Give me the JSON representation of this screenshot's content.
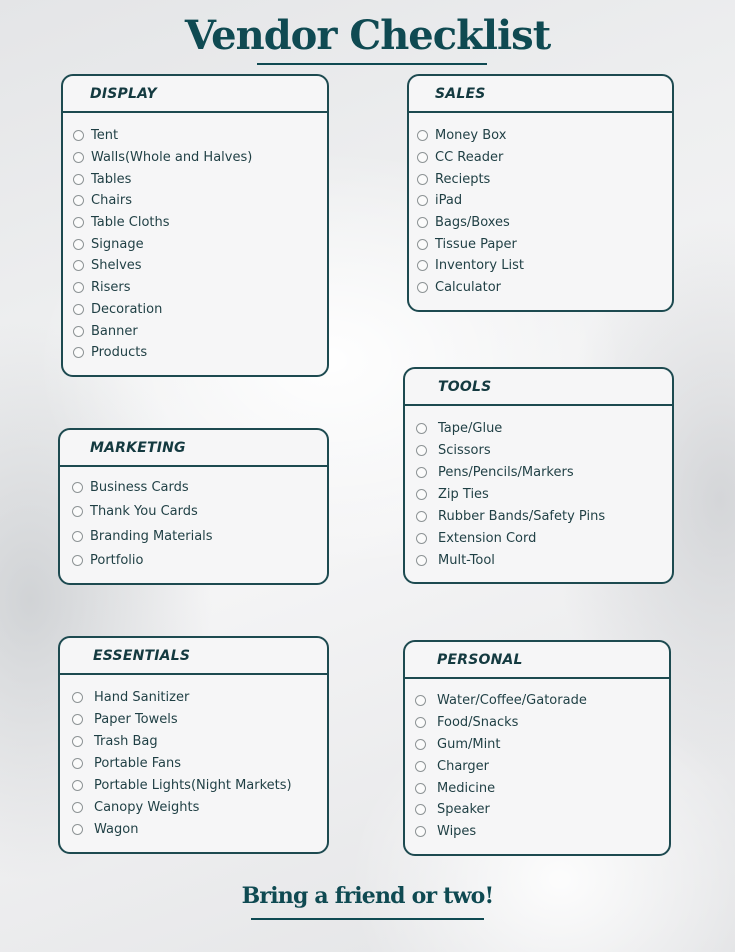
{
  "title": "Vendor Checklist",
  "footer": "Bring a friend or two!",
  "colors": {
    "accent": "#0f4a52",
    "border": "#1d4a50",
    "text": "#1f3f44",
    "card_bg": "#f6f6f7"
  },
  "sections": {
    "display": {
      "title": "DISPLAY",
      "items": [
        "Tent",
        "Walls(Whole and Halves)",
        "Tables",
        "Chairs",
        "Table Cloths",
        "Signage",
        "Shelves",
        "Risers",
        "Decoration",
        "Banner",
        "Products"
      ]
    },
    "sales": {
      "title": "SALES",
      "items": [
        "Money Box",
        "CC Reader",
        "Reciepts",
        "iPad",
        "Bags/Boxes",
        "Tissue Paper",
        "Inventory List",
        "Calculator"
      ]
    },
    "marketing": {
      "title": "MARKETING",
      "items": [
        "Business Cards",
        "Thank You Cards",
        "Branding Materials",
        "Portfolio"
      ]
    },
    "tools": {
      "title": "TOOLS",
      "items": [
        "Tape/Glue",
        "Scissors",
        "Pens/Pencils/Markers",
        "Zip Ties",
        "Rubber Bands/Safety Pins",
        "Extension Cord",
        "Mult-Tool"
      ]
    },
    "essentials": {
      "title": "ESSENTIALS",
      "items": [
        "Hand Sanitizer",
        "Paper Towels",
        "Trash Bag",
        "Portable Fans",
        "Portable Lights(Night Markets)",
        "Canopy Weights",
        "Wagon"
      ]
    },
    "personal": {
      "title": "PERSONAL",
      "items": [
        "Water/Coffee/Gatorade",
        "Food/Snacks",
        "Gum/Mint",
        "Charger",
        "Medicine",
        "Speaker",
        "Wipes"
      ]
    }
  }
}
